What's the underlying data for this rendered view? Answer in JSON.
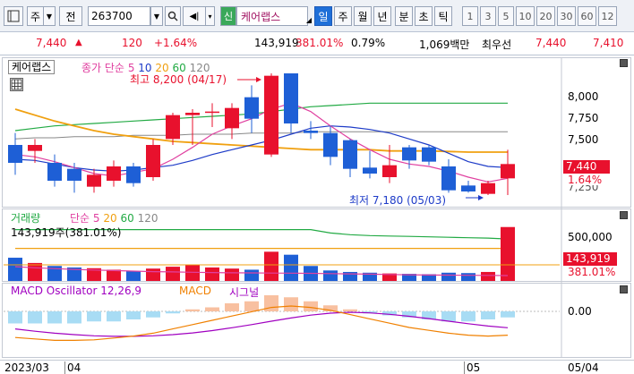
{
  "toolbar": {
    "code_label_1": "주",
    "code_label_2": "전",
    "stock_code": "263700",
    "stock_name": "케어랩스",
    "stock_badge": "신",
    "periods": [
      "일",
      "주",
      "월",
      "년",
      "분",
      "초",
      "틱"
    ],
    "active_period": "일",
    "intervals": [
      "1",
      "3",
      "5",
      "10",
      "20",
      "30",
      "60",
      "12"
    ]
  },
  "quote": {
    "price": "7,440",
    "change": "120",
    "change_pct": "+1.64%",
    "volume": "143,919",
    "volume_ratio": "381.01%",
    "turnover": "0.79%",
    "amount": "1,069백만",
    "order_label": "최우선",
    "ask": "7,440",
    "bid": "7,410"
  },
  "price_panel": {
    "title": "케어랩스",
    "ma_label": "종가 단순",
    "ma_periods": [
      "5",
      "10",
      "20",
      "60",
      "120"
    ],
    "max_label": "최고 8,200 (04/17)",
    "min_label": "최저 7,180 (05/03)",
    "ticks": [
      "8,000",
      "7,750",
      "7,500"
    ],
    "tick_partial": "7,250",
    "last_price": "7,440",
    "last_pct": "1.64%"
  },
  "volume_panel": {
    "title": "거래량",
    "ma_label": "단순",
    "ma_periods": [
      "5",
      "20",
      "60",
      "120"
    ],
    "volume_text": "143,919주(381.01%)",
    "tick": "500,000",
    "last_volume": "143,919",
    "last_pct": "381.01%"
  },
  "macd_panel": {
    "title": "MACD Oscillator 12,26,9",
    "macd_label": "MACD",
    "signal_label": "시그널",
    "tick": "0.00"
  },
  "x_axis": {
    "labels": [
      "2023/03",
      "04",
      "05",
      "05/04"
    ]
  },
  "colors": {
    "up": "#e8112d",
    "down": "#1e5fd6",
    "ma5": "#e040a0",
    "ma10": "#1e3cc8",
    "ma20": "#f0a010",
    "ma60": "#22aa44",
    "ma120": "#888888"
  },
  "chart_data": {
    "type": "candlestick",
    "title": "케어랩스",
    "candles": [
      {
        "o": 7600,
        "c": 7450,
        "h": 7700,
        "l": 7350
      },
      {
        "o": 7550,
        "c": 7600,
        "h": 7650,
        "l": 7450
      },
      {
        "o": 7450,
        "c": 7300,
        "h": 7520,
        "l": 7250
      },
      {
        "o": 7400,
        "c": 7300,
        "h": 7450,
        "l": 7200
      },
      {
        "o": 7250,
        "c": 7350,
        "h": 7400,
        "l": 7200
      },
      {
        "o": 7300,
        "c": 7420,
        "h": 7470,
        "l": 7250
      },
      {
        "o": 7420,
        "c": 7280,
        "h": 7450,
        "l": 7250
      },
      {
        "o": 7330,
        "c": 7600,
        "h": 7650,
        "l": 7300
      },
      {
        "o": 7650,
        "c": 7850,
        "h": 7870,
        "l": 7600
      },
      {
        "o": 7850,
        "c": 7870,
        "h": 7900,
        "l": 7600
      },
      {
        "o": 7870,
        "c": 7880,
        "h": 7950,
        "l": 7750
      },
      {
        "o": 7740,
        "c": 7910,
        "h": 7950,
        "l": 7650
      },
      {
        "o": 8000,
        "c": 7820,
        "h": 8100,
        "l": 7700
      },
      {
        "o": 7520,
        "c": 8180,
        "h": 8200,
        "l": 7500
      },
      {
        "o": 8200,
        "c": 7780,
        "h": 8200,
        "l": 7700
      },
      {
        "o": 7720,
        "c": 7700,
        "h": 7800,
        "l": 7650
      },
      {
        "o": 7700,
        "c": 7500,
        "h": 7760,
        "l": 7430
      },
      {
        "o": 7640,
        "c": 7400,
        "h": 7650,
        "l": 7330
      },
      {
        "o": 7410,
        "c": 7360,
        "h": 7550,
        "l": 7320
      },
      {
        "o": 7330,
        "c": 7430,
        "h": 7600,
        "l": 7280
      },
      {
        "o": 7580,
        "c": 7470,
        "h": 7600,
        "l": 7400
      },
      {
        "o": 7580,
        "c": 7460,
        "h": 7600,
        "l": 7430
      },
      {
        "o": 7420,
        "c": 7220,
        "h": 7480,
        "l": 7200
      },
      {
        "o": 7260,
        "c": 7210,
        "h": 7300,
        "l": 7200
      },
      {
        "o": 7190,
        "c": 7280,
        "h": 7300,
        "l": 7180
      },
      {
        "o": 7320,
        "c": 7440,
        "h": 7560,
        "l": 7180
      }
    ],
    "ma5": [
      7520,
      7500,
      7460,
      7410,
      7360,
      7340,
      7370,
      7400,
      7480,
      7580,
      7690,
      7760,
      7820,
      7900,
      7950,
      7880,
      7760,
      7650,
      7560,
      7480,
      7440,
      7420,
      7380,
      7330,
      7290,
      7320
    ],
    "ma10": [
      7480,
      7470,
      7440,
      7410,
      7390,
      7380,
      7390,
      7410,
      7430,
      7470,
      7520,
      7560,
      7600,
      7640,
      7690,
      7740,
      7760,
      7750,
      7730,
      7700,
      7650,
      7600,
      7530,
      7460,
      7420,
      7410
    ],
    "ma20": [
      7900,
      7850,
      7800,
      7760,
      7720,
      7690,
      7670,
      7650,
      7630,
      7620,
      7610,
      7600,
      7590,
      7580,
      7570,
      7560,
      7560,
      7560,
      7560,
      7550,
      7550,
      7550,
      7545,
      7540,
      7540,
      7540
    ],
    "ma60": [
      7720,
      7740,
      7760,
      7770,
      7780,
      7790,
      7800,
      7810,
      7820,
      7830,
      7840,
      7850,
      7860,
      7880,
      7900,
      7920,
      7930,
      7940,
      7950,
      7950,
      7950,
      7950,
      7950,
      7950,
      7950,
      7950
    ],
    "ma120": [
      7650,
      7660,
      7660,
      7670,
      7670,
      7670,
      7680,
      7680,
      7680,
      7690,
      7690,
      7690,
      7700,
      7700,
      7700,
      7710,
      7710,
      7710,
      7710,
      7710,
      7710,
      7710,
      7710,
      7710,
      7710,
      7710
    ],
    "volume": [
      62000,
      48000,
      40000,
      36000,
      34000,
      30000,
      26000,
      33000,
      38000,
      44000,
      36000,
      33000,
      30000,
      78000,
      70000,
      40000,
      28000,
      24000,
      22000,
      20000,
      19000,
      18000,
      22000,
      21000,
      24000,
      143919
    ],
    "volume_ma5": [
      64000,
      60000,
      57000,
      54000,
      52000,
      50000,
      48000,
      46000,
      45000,
      44000,
      43000,
      42000,
      41500,
      41000,
      40500,
      40000,
      39000,
      38000,
      37000,
      36000,
      35000,
      34000,
      33500,
      33000,
      32500,
      32000
    ],
    "volume_ma20": [
      380000,
      380000,
      380000,
      380000,
      380000,
      380000,
      380000,
      380000,
      380000,
      380000,
      380000,
      380000,
      380000,
      380000,
      380000,
      380000,
      380000,
      380000,
      380000,
      380000,
      380000,
      380000,
      380000,
      380000,
      380000,
      380000
    ],
    "volume_ma60": [
      600000,
      600000,
      600000,
      600000,
      600000,
      600000,
      600000,
      600000,
      600000,
      600000,
      600000,
      600000,
      600000,
      600000,
      600000,
      600000,
      560000,
      540000,
      530000,
      525000,
      520000,
      515000,
      510000,
      505000,
      500000,
      490000
    ],
    "macd_osc": [
      -3,
      -3,
      -3,
      -3,
      -2.5,
      -2.5,
      -2,
      -1.5,
      -0.5,
      0.5,
      1,
      2,
      2.5,
      4,
      3.5,
      2.5,
      1.5,
      0.5,
      -0.5,
      -1,
      -1.5,
      -2,
      -2.5,
      -2.5,
      -2,
      -1.5
    ],
    "macd": [
      -6,
      -6.5,
      -7,
      -7,
      -6.8,
      -6.2,
      -5.5,
      -4.5,
      -3,
      -1.5,
      0,
      1.5,
      3,
      4.5,
      5,
      4.5,
      3.5,
      2,
      0.5,
      -1,
      -2.5,
      -3.5,
      -4.5,
      -5.2,
      -5.5,
      -5.2
    ],
    "signal": [
      -3,
      -3.8,
      -4.5,
      -5,
      -5.4,
      -5.6,
      -5.6,
      -5.4,
      -5,
      -4.4,
      -3.6,
      -2.6,
      -1.5,
      -0.3,
      0.8,
      1.8,
      2.5,
      2.8,
      2.6,
      2.1,
      1.4,
      0.6,
      -0.3,
      -1.2,
      -2,
      -2.6
    ],
    "ylim": [
      7180,
      8200
    ],
    "x_labels": [
      "2023/03",
      "04",
      "05",
      "05/04"
    ]
  }
}
